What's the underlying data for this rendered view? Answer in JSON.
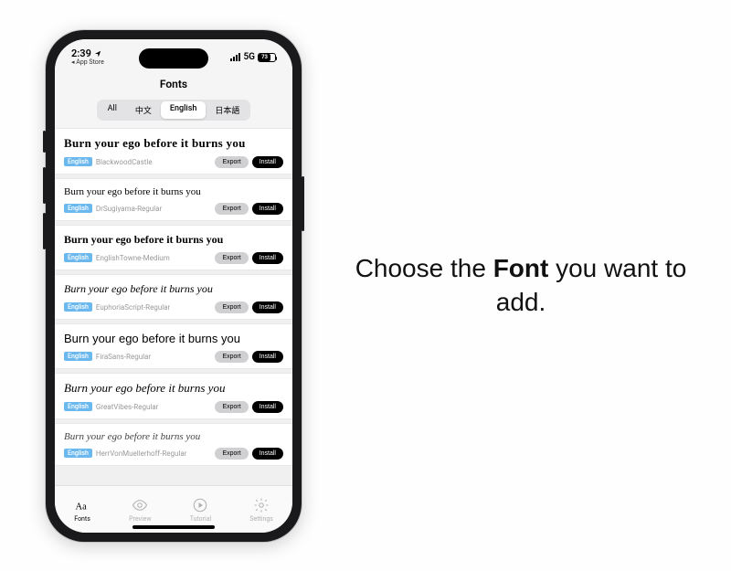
{
  "status": {
    "time": "2:39",
    "back_label": "App Store",
    "network": "5G",
    "battery_pct": "73"
  },
  "header": {
    "title": "Fonts"
  },
  "segments": {
    "items": [
      "All",
      "中文",
      "English",
      "日本語"
    ],
    "active_index": 2
  },
  "labels": {
    "export": "Export",
    "install": "Install",
    "lang_badge": "English"
  },
  "sample_sentence": "Burn your ego before it burns you",
  "fonts": [
    {
      "name": "BlackwoodCastle",
      "style_class": "f-blackletter"
    },
    {
      "name": "DrSugiyama-Regular",
      "style_class": "f-script1"
    },
    {
      "name": "EnglishTowne-Medium",
      "style_class": "f-blackletter2"
    },
    {
      "name": "EuphoriaScript-Regular",
      "style_class": "f-italic-script"
    },
    {
      "name": "FiraSans-Regular",
      "style_class": "f-sans"
    },
    {
      "name": "GreatVibes-Regular",
      "style_class": "f-great"
    },
    {
      "name": "HerrVonMuellerhoff-Regular",
      "style_class": "f-herr"
    }
  ],
  "tabs": [
    {
      "id": "fonts",
      "label": "Fonts",
      "active": true
    },
    {
      "id": "preview",
      "label": "Preview",
      "active": false
    },
    {
      "id": "tutorial",
      "label": "Tutorial",
      "active": false
    },
    {
      "id": "settings",
      "label": "Settings",
      "active": false
    }
  ],
  "caption": {
    "pre": "Choose the ",
    "bold": "Font",
    "post": " you want to add."
  }
}
